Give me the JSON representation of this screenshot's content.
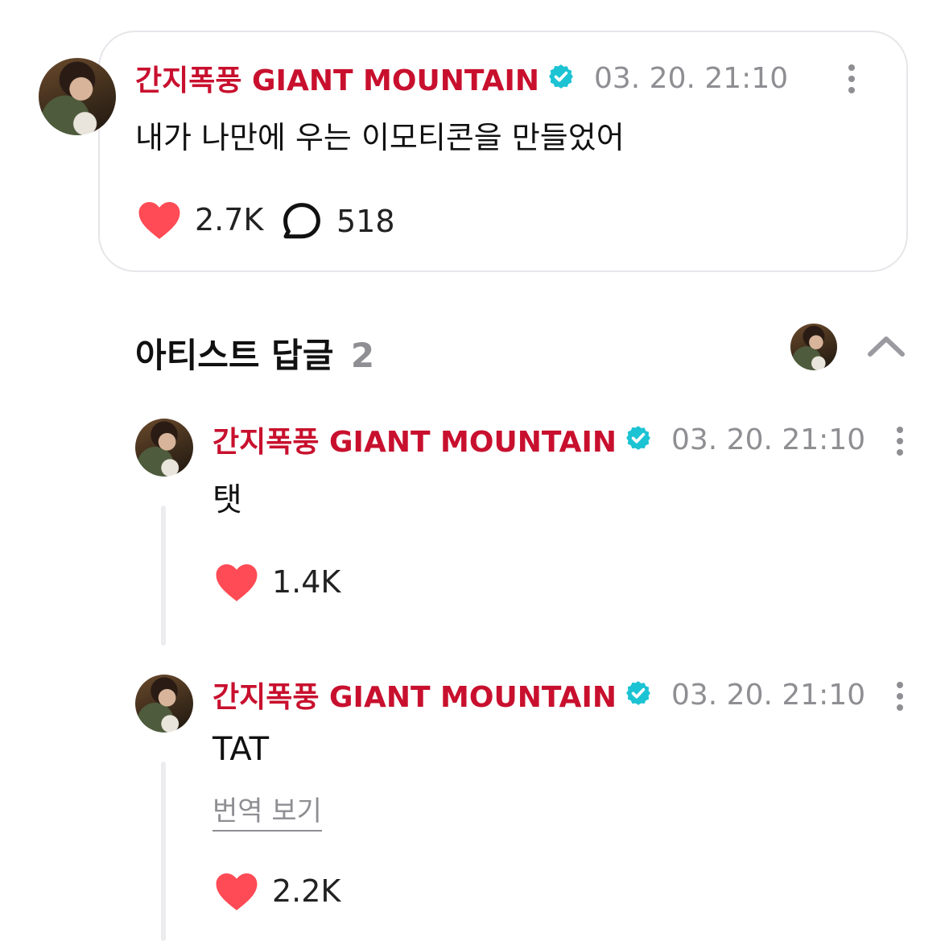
{
  "post": {
    "author": "간지폭풍 GIANT MOUNTAIN",
    "time": "03. 20. 21:10",
    "text": "내가 나만에 우는 이모티콘을 만들었어",
    "likes": "2.7K",
    "comments": "518"
  },
  "artist_replies": {
    "title": "아티스트 답글",
    "count": "2"
  },
  "replies": [
    {
      "author": "간지폭풍 GIANT MOUNTAIN",
      "time": "03. 20. 21:10",
      "text": "탯",
      "likes": "1.4K"
    },
    {
      "author": "간지폭풍 GIANT MOUNTAIN",
      "time": "03. 20. 21:10",
      "text": "TAT",
      "translate": "번역 보기",
      "likes": "2.2K"
    }
  ],
  "colors": {
    "author": "#c8102e",
    "verified": "#1cc3d3",
    "heart": "#ff4b55",
    "muted": "#8e8e93"
  },
  "icons": [
    "avatar",
    "verified-badge-icon",
    "more-vertical-icon",
    "heart-icon",
    "comment-bubble-icon",
    "chevron-up-icon"
  ]
}
